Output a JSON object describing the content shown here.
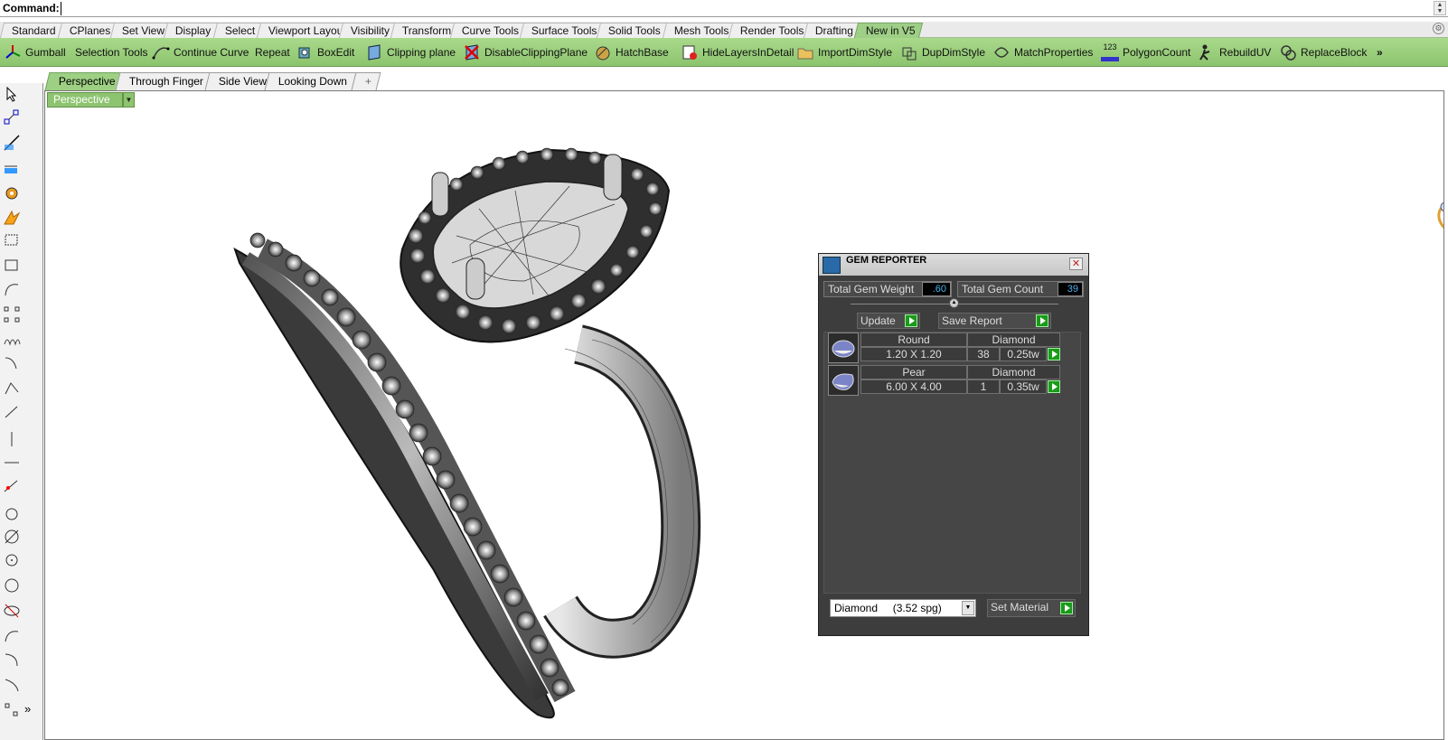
{
  "command": {
    "label": "Command:",
    "value": ""
  },
  "toolbar_tabs": [
    {
      "label": "Standard"
    },
    {
      "label": "CPlanes"
    },
    {
      "label": "Set View"
    },
    {
      "label": "Display"
    },
    {
      "label": "Select"
    },
    {
      "label": "Viewport Layout"
    },
    {
      "label": "Visibility"
    },
    {
      "label": "Transform"
    },
    {
      "label": "Curve Tools"
    },
    {
      "label": "Surface Tools"
    },
    {
      "label": "Solid Tools"
    },
    {
      "label": "Mesh Tools"
    },
    {
      "label": "Render Tools"
    },
    {
      "label": "Drafting"
    },
    {
      "label": "New in V5"
    }
  ],
  "toolbar": [
    {
      "label": "Gumball",
      "icon": "gumball-icon"
    },
    {
      "label": "Selection Tools",
      "icon": ""
    },
    {
      "label": "Continue Curve",
      "icon": "curve-icon"
    },
    {
      "label": "Repeat",
      "icon": ""
    },
    {
      "label": "BoxEdit",
      "icon": "boxedit-icon"
    },
    {
      "label": "Clipping plane",
      "icon": "clipping-plane-icon"
    },
    {
      "label": "DisableClippingPlane",
      "icon": "disable-clipping-icon"
    },
    {
      "label": "HatchBase",
      "icon": "hatch-icon"
    },
    {
      "label": "HideLayersInDetail",
      "icon": "hide-layers-icon"
    },
    {
      "label": "ImportDimStyle",
      "icon": "folder-icon"
    },
    {
      "label": "DupDimStyle",
      "icon": "dimstyle-icon"
    },
    {
      "label": "MatchProperties",
      "icon": "match-properties-icon"
    },
    {
      "label": "PolygonCount",
      "icon": "polygon-count-icon",
      "icon_text": "123"
    },
    {
      "label": "RebuildUV",
      "icon": "rebuild-uv-icon"
    },
    {
      "label": "ReplaceBlock",
      "icon": "replace-block-icon"
    }
  ],
  "toolbar_more": "»",
  "viewport_tabs": [
    {
      "label": "Perspective"
    },
    {
      "label": "Through Finger"
    },
    {
      "label": "Side View"
    },
    {
      "label": "Looking Down"
    },
    {
      "label": "+"
    }
  ],
  "viewport": {
    "title": "Perspective"
  },
  "left_tools_more": "»",
  "gem_reporter": {
    "title": "GEM REPORTER",
    "close": "✕",
    "total_weight_label": "Total Gem Weight",
    "total_weight": ".60",
    "total_count_label": "Total Gem Count",
    "total_count": "39",
    "update_label": "Update",
    "save_report_label": "Save Report",
    "rows": [
      {
        "cut": "Round",
        "material": "Diamond",
        "size": "1.20 X 1.20",
        "count": "38",
        "weight": "0.25tw"
      },
      {
        "cut": "Pear",
        "material": "Diamond",
        "size": "6.00 X 4.00",
        "count": "1",
        "weight": "0.35tw"
      }
    ],
    "material_selected": "Diamond     (3.52 spg)",
    "set_material_label": "Set Material"
  },
  "colors": {
    "toolbar_green": "#94cc76",
    "active_tab": "#9fcf86",
    "panel_dark": "#3d3d3d",
    "value_blue": "#4ab0e8",
    "arrow_green": "#1b9a1b"
  }
}
